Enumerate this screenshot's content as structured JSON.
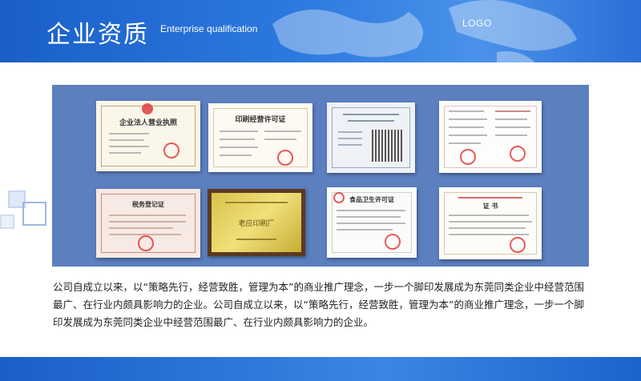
{
  "header": {
    "title": "企业资质",
    "subtitle": "Enterprise qualification",
    "logo": "LOGO"
  },
  "certificates": [
    {
      "name": "营业执照",
      "label": "企业法人营业执照"
    },
    {
      "name": "印刷经营许可证",
      "label": "印刷经营许可证"
    },
    {
      "name": "组织机构代码证",
      "label": ""
    },
    {
      "name": "资质证书",
      "label": ""
    },
    {
      "name": "税务登记证",
      "label": "税务登记证"
    },
    {
      "name": "牌匾",
      "label": "老应印刷厂"
    },
    {
      "name": "食品卫生许可证",
      "label": "食品卫生许可证"
    },
    {
      "name": "证书",
      "label": "证  书"
    }
  ],
  "description": "公司自成立以来，以“策略先行，经营致胜，管理为本”的商业推广理念，一步一个脚印发展成为东莞同类企业中经营范围最广、在行业内颇具影响力的企业。公司自成立以来，以“策略先行，经营致胜，管理为本”的商业推广理念，一步一个脚印发展成为东莞同类企业中经营范围最广、在行业内颇具影响力的企业。",
  "colors": {
    "header_blue": "#2c78de",
    "panel_blue": "#5b7fbf"
  }
}
